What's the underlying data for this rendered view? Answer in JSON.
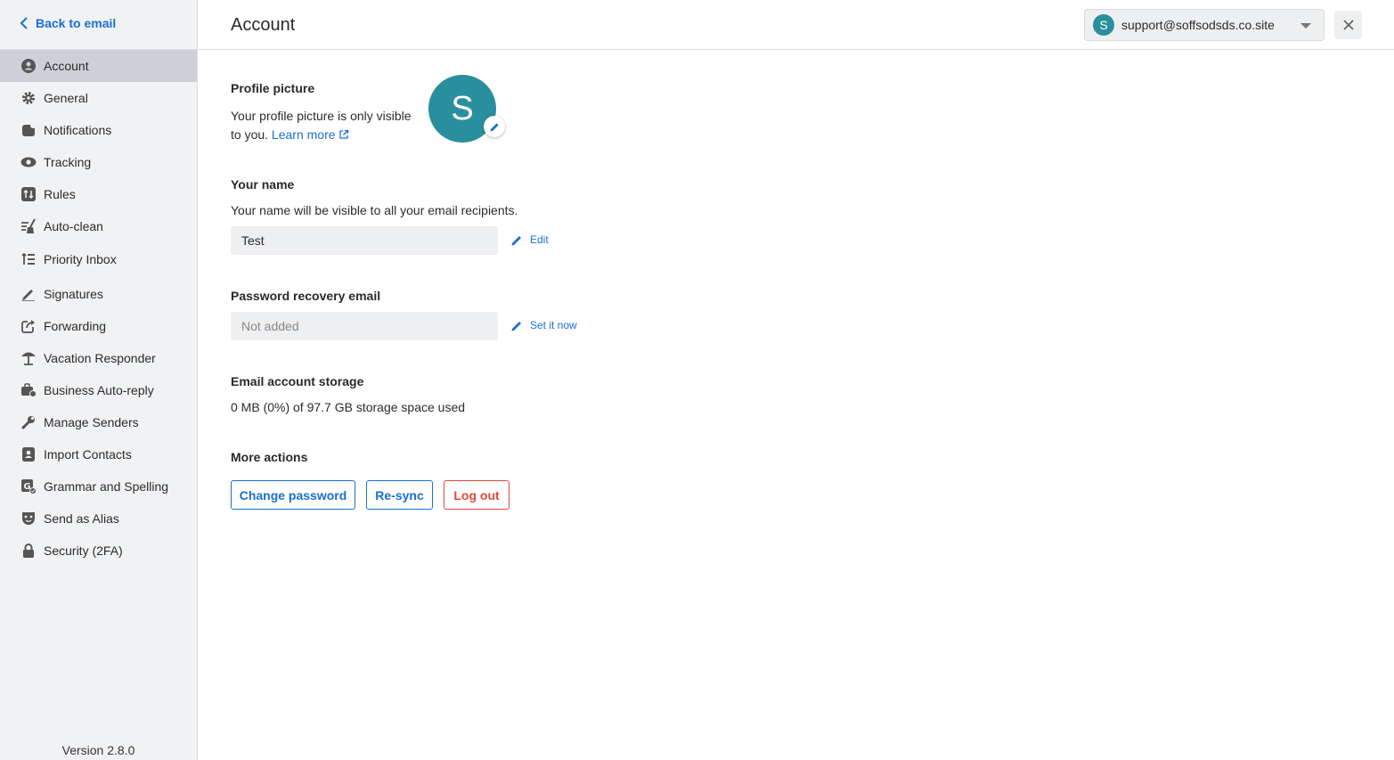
{
  "sidebar": {
    "back_label": "Back to email",
    "items": [
      {
        "label": "Account",
        "icon": "user-circle-icon"
      },
      {
        "label": "General",
        "icon": "gear-icon"
      },
      {
        "label": "Notifications",
        "icon": "bell-icon"
      },
      {
        "label": "Tracking",
        "icon": "eye-icon"
      },
      {
        "label": "Rules",
        "icon": "rules-icon"
      },
      {
        "label": "Auto-clean",
        "icon": "broom-icon"
      },
      {
        "label": "Priority Inbox",
        "icon": "priority-list-icon"
      },
      {
        "label": "Signatures",
        "icon": "pen-icon"
      },
      {
        "label": "Forwarding",
        "icon": "share-icon"
      },
      {
        "label": "Vacation Responder",
        "icon": "umbrella-beach-icon"
      },
      {
        "label": "Business Auto-reply",
        "icon": "briefcase-icon"
      },
      {
        "label": "Manage Senders",
        "icon": "wrench-icon"
      },
      {
        "label": "Import Contacts",
        "icon": "contact-book-icon"
      },
      {
        "label": "Grammar and Spelling",
        "icon": "grammar-check-icon"
      },
      {
        "label": "Send as Alias",
        "icon": "mask-icon"
      },
      {
        "label": "Security (2FA)",
        "icon": "lock-icon"
      }
    ],
    "version": "Version 2.8.0"
  },
  "header": {
    "title": "Account",
    "account_initial": "S",
    "account_email": "support@soffsodsds.co.site"
  },
  "profile": {
    "title": "Profile picture",
    "desc_line1": "Your profile picture is only visible",
    "desc_line2": "to you.",
    "learn_more": "Learn more",
    "avatar_initial": "S"
  },
  "name": {
    "title": "Your name",
    "desc": "Your name will be visible to all your email recipients.",
    "value": "Test",
    "edit_label": "Edit"
  },
  "recovery": {
    "title": "Password recovery email",
    "value": "Not added",
    "action_label": "Set it now"
  },
  "storage": {
    "title": "Email account storage",
    "desc": "0 MB (0%) of 97.7 GB storage space used"
  },
  "actions": {
    "title": "More actions",
    "change_password": "Change password",
    "resync": "Re-sync",
    "logout": "Log out"
  },
  "colors": {
    "accent": "#1a6fd1",
    "avatar": "#2a8f9c",
    "danger": "#e0483d"
  }
}
